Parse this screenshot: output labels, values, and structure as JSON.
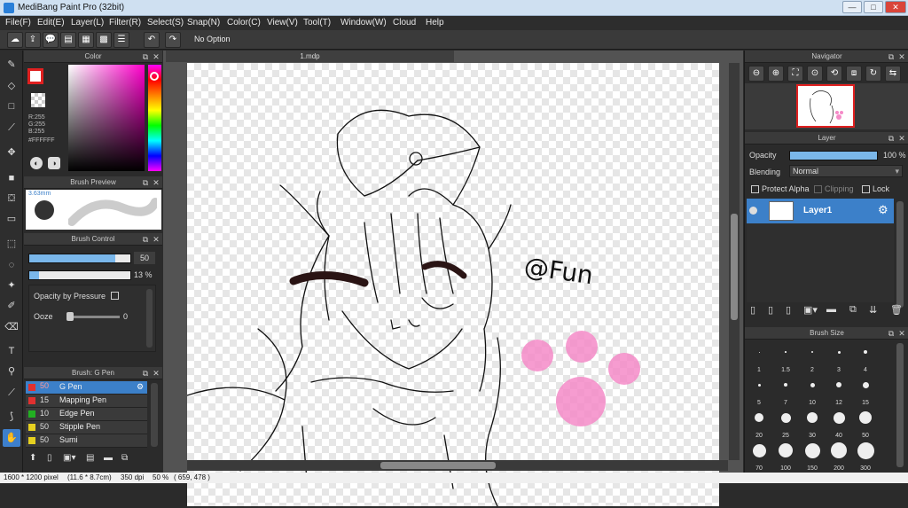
{
  "window": {
    "title": "MediBang Paint Pro (32bit)",
    "min": "—",
    "max": "□",
    "close": "✕"
  },
  "menu": [
    "File(F)",
    "Edit(E)",
    "Layer(L)",
    "Filter(R)",
    "Select(S)",
    "Snap(N)",
    "Color(C)",
    "View(V)",
    "Tool(T)",
    "Window(W)",
    "Cloud",
    "Help"
  ],
  "toolbar": {
    "option_text": "No Option"
  },
  "colors": {
    "accent": "#3c80c9",
    "primary_color": "#ffffff",
    "panel_bg": "#2b2b2b"
  },
  "color_panel": {
    "title": "Color",
    "r": "R:255",
    "g": "G:255",
    "b": "B:255",
    "hex": "#FFFFFF"
  },
  "brush_preview": {
    "title": "Brush Preview",
    "size": "3.63mm"
  },
  "brush_control": {
    "title": "Brush Control",
    "size_value": 50,
    "opacity_value": "13 %",
    "size_fraction": 0.85,
    "opacity_fraction": 0.1,
    "opacity_pressure_label": "Opacity by Pressure",
    "ooze_label": "Ooze",
    "ooze_value": "0"
  },
  "brush_list": {
    "title": "Brush: G Pen",
    "items": [
      {
        "size": "50",
        "name": "G Pen",
        "color": "#e03030",
        "selected": true
      },
      {
        "size": "15",
        "name": "Mapping Pen",
        "color": "#e03030"
      },
      {
        "size": "10",
        "name": "Edge Pen",
        "color": "#22b022"
      },
      {
        "size": "50",
        "name": "Stipple Pen",
        "color": "#e6d020"
      },
      {
        "size": "50",
        "name": "Sumi",
        "color": "#e6d020"
      }
    ]
  },
  "canvas": {
    "tab": "1.mdp",
    "text_drawn": "@Fun"
  },
  "navigator": {
    "title": "Navigator"
  },
  "layer_panel": {
    "title": "Layer",
    "opacity_label": "Opacity",
    "opacity_value": "100 %",
    "opacity_fraction": 1.0,
    "blending_label": "Blending",
    "blending_value": "Normal",
    "protect_alpha": "Protect Alpha",
    "clipping": "Clipping",
    "lock": "Lock",
    "layers": [
      {
        "name": "Layer1"
      }
    ]
  },
  "brush_size": {
    "title": "Brush Size",
    "sizes": [
      "1",
      "1.5",
      "2",
      "3",
      "4",
      "5",
      "7",
      "10",
      "12",
      "15",
      "20",
      "25",
      "30",
      "40",
      "50",
      "70",
      "100",
      "150",
      "200",
      "300"
    ]
  },
  "status": {
    "dimensions": "1600 * 1200 pixel",
    "cm": "(11.6 * 8.7cm)",
    "dpi": "350 dpi",
    "zoom": "50 %",
    "coords": "( 659, 478 )"
  }
}
